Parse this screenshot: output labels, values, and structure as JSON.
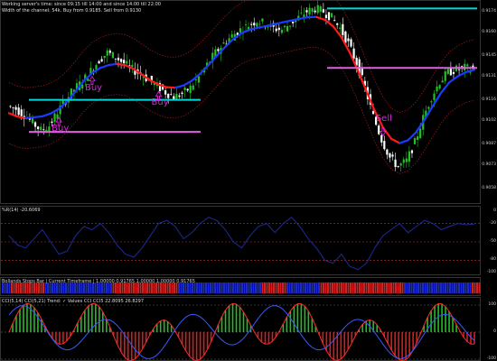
{
  "header": {
    "line1": "Working server's time: since 09:15 till 14:00 and since 14:00 till 22:00",
    "line2": "Width of the channel: 54k. Buy from 0.9185. Sell from 0.9130"
  },
  "colors": {
    "background": "#000000",
    "bull_candle": "#22c022",
    "bear_candle": "#ffffff",
    "ma_up": "#1a3cff",
    "ma_down": "#ff1a1a",
    "band": "#8b1a1a",
    "cyan_level": "#00d8d8",
    "magenta_level": "#e060e0",
    "signal": "#e020e0",
    "rsi_line": "#1e2a9a",
    "hist_blue": "#1a2ad0",
    "hist_red": "#d02020",
    "cci_green": "#20c020",
    "cci_red": "#ff2a2a",
    "cci_blue": "#3a5aff"
  },
  "panels": {
    "rsi_label": "%R(14) -20.6069",
    "stops_label": "Bollands Stops Bar  |  Current Timeframe  |  1.00000  0.91765  1.00000  1.00000  0.91765",
    "cci_label": "CCI(5,14) CCI(5,21)  Trend:  ✓  Values CCI  CCI5 22.8095  26.8297"
  },
  "chart_data": [
    {
      "type": "candlestick",
      "title": "",
      "price_ticks": [
        "0.9174",
        "0.9160",
        "0.9145",
        "0.9131",
        "0.9116",
        "0.9102",
        "0.9087",
        "0.9073",
        "0.9058"
      ],
      "ylim": [
        0.905,
        0.9178
      ],
      "close": [
        0.9112,
        0.911,
        0.9106,
        0.9101,
        0.9096,
        0.9099,
        0.9108,
        0.9116,
        0.9123,
        0.9128,
        0.9135,
        0.9142,
        0.9147,
        0.9144,
        0.914,
        0.9136,
        0.9133,
        0.9129,
        0.9125,
        0.9121,
        0.9118,
        0.912,
        0.9124,
        0.9131,
        0.9139,
        0.9147,
        0.9153,
        0.9158,
        0.9162,
        0.9165,
        0.9168,
        0.9166,
        0.9163,
        0.9162,
        0.9166,
        0.917,
        0.9174,
        0.9176,
        0.9174,
        0.917,
        0.9163,
        0.9153,
        0.914,
        0.9124,
        0.9105,
        0.909,
        0.9078,
        0.9072,
        0.9076,
        0.9088,
        0.9104,
        0.9118,
        0.9128,
        0.9134,
        0.9136,
        0.9137,
        0.9136
      ],
      "levels": [
        {
          "name": "Buy",
          "value": 0.9116,
          "color": "cyan"
        },
        {
          "name": "Buy",
          "value": 0.9095,
          "color": "magenta"
        },
        {
          "name": "Sell",
          "value": 0.9137,
          "color": "magenta"
        },
        {
          "name": "Sell",
          "value": 0.9176,
          "color": "cyan"
        }
      ],
      "annotations": [
        {
          "text": "Buy",
          "index": 6
        },
        {
          "text": "Buy",
          "index": 10
        },
        {
          "text": "Buy",
          "index": 18
        },
        {
          "text": "Sell",
          "index": 45
        }
      ]
    },
    {
      "type": "line",
      "title": "%R(14) -20.6069",
      "ticks": [
        "0",
        "-20",
        "-50",
        "-80",
        "-100"
      ],
      "ylim": [
        -100,
        0
      ],
      "values": [
        -40,
        -55,
        -60,
        -45,
        -30,
        -50,
        -70,
        -65,
        -40,
        -25,
        -30,
        -20,
        -35,
        -55,
        -70,
        -75,
        -60,
        -40,
        -20,
        -15,
        -25,
        -45,
        -35,
        -20,
        -10,
        -15,
        -30,
        -50,
        -60,
        -40,
        -25,
        -20,
        -35,
        -20,
        -10,
        -25,
        -45,
        -60,
        -80,
        -85,
        -70,
        -90,
        -95,
        -85,
        -60,
        -40,
        -30,
        -20,
        -35,
        -25,
        -15,
        -20,
        -30,
        -25,
        -20,
        -22,
        -21
      ]
    }
  ]
}
